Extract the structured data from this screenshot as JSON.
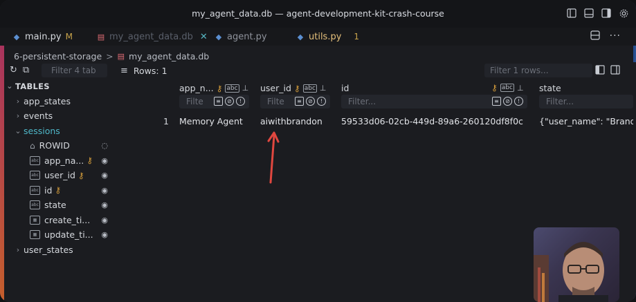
{
  "window": {
    "title": "my_agent_data.db — agent-development-kit-crash-course"
  },
  "title_icons": [
    "layout-sidebar-left-icon",
    "layout-panel-icon",
    "layout-sidebar-right-icon",
    "settings-gear-icon"
  ],
  "tabs": [
    {
      "label": "main.py",
      "badge": "M",
      "icon": "python-icon",
      "color": "#d6d9de"
    },
    {
      "label": "my_agent_data.db",
      "close": "✕",
      "icon": "database-icon",
      "active": true
    },
    {
      "label": "agent.py",
      "icon": "python-icon"
    },
    {
      "label": "utils.py",
      "badge": "1",
      "icon": "python-icon",
      "color": "#e5c07b"
    }
  ],
  "breadcrumb": {
    "folder": "6-persistent-storage",
    "separator": ">",
    "file": "my_agent_data.db"
  },
  "sidebar": {
    "filter_placeholder": "Filter 4 tab",
    "section": "TABLES",
    "tables": [
      {
        "name": "app_states",
        "expanded": false
      },
      {
        "name": "events",
        "expanded": false
      },
      {
        "name": "sessions",
        "expanded": true
      },
      {
        "name": "user_states",
        "expanded": false
      }
    ],
    "columns": [
      {
        "name": "ROWID",
        "type": "rowid",
        "key": false,
        "visible": false
      },
      {
        "name": "app_na...",
        "type": "text",
        "key": true,
        "visible": true
      },
      {
        "name": "user_id",
        "type": "text",
        "key": true,
        "visible": true
      },
      {
        "name": "id",
        "type": "text",
        "key": true,
        "visible": true
      },
      {
        "name": "state",
        "type": "text",
        "key": false,
        "visible": true
      },
      {
        "name": "create_ti...",
        "type": "table",
        "key": false,
        "visible": true
      },
      {
        "name": "update_ti...",
        "type": "table",
        "key": false,
        "visible": true
      }
    ]
  },
  "grid": {
    "rows_label": "Rows: 1",
    "row_filter_placeholder": "Filter 1 rows...",
    "headers": [
      {
        "label": "app_n...",
        "filter": "Filte"
      },
      {
        "label": "user_id",
        "filter": "Filte"
      },
      {
        "label": "id",
        "filter": "Filter..."
      },
      {
        "label": "state",
        "filter": "Filter..."
      }
    ],
    "rows": [
      {
        "num": "1",
        "cells": [
          "Memory Agent",
          "aiwithbrandon",
          "59533d06-02cb-449d-89a6-260120df8f0c",
          "{\"user_name\": \"Brand"
        ]
      }
    ]
  },
  "colors": {
    "accent_cyan": "#4fb8c9",
    "key_gold": "#d29b3a",
    "db_red": "#e06c75",
    "arrow_red": "#e0473f"
  }
}
